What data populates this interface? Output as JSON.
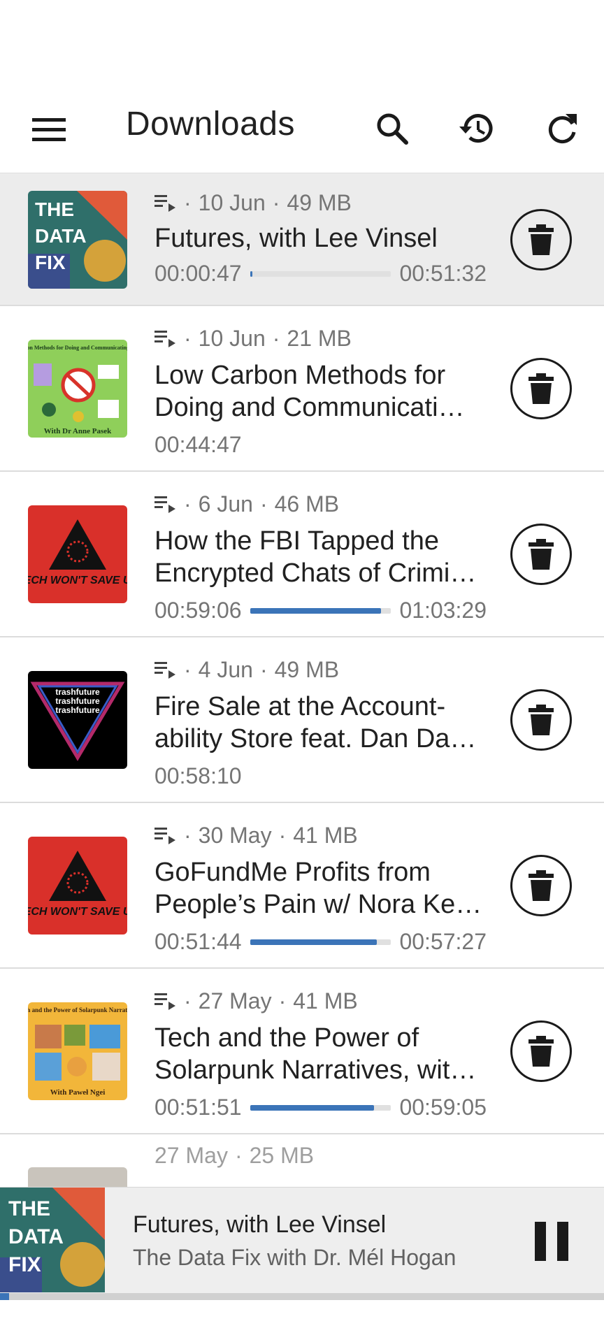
{
  "app": {
    "title": "Downloads",
    "accent_color": "#3b74b8"
  },
  "toolbar": {
    "menu_icon": "hamburger-icon",
    "search_icon": "search-icon",
    "history_icon": "history-icon",
    "refresh_icon": "refresh-icon"
  },
  "episodes": [
    {
      "date": "10 Jun",
      "size": "49 MB",
      "title": "Futures, with Lee Vinsel",
      "position": "00:00:47",
      "duration": "00:51:32",
      "progress": 0.015,
      "artwork": "The Data Fix",
      "artwork_lines": [
        "THE",
        "DATA",
        "FIX"
      ]
    },
    {
      "date": "10 Jun",
      "size": "21 MB",
      "title": "Low Carbon Methods for Doing and Communicati…",
      "duration": "00:44:47",
      "artwork": "Low Carbon Methods",
      "artwork_top": "Low Carbon Methods for Doing and Communicating Research",
      "artwork_bottom": "With Dr Anne Pasek"
    },
    {
      "date": "6 Jun",
      "size": "46 MB",
      "title": "How the FBI Tapped the Encrypted Chats of Crimi…",
      "position": "00:59:06",
      "duration": "01:03:29",
      "progress": 0.93,
      "artwork": "Tech Won't Save Us",
      "artwork_text": "TECH WON'T SAVE US"
    },
    {
      "date": "4 Jun",
      "size": "49 MB",
      "title": "Fire Sale at the Account-ability Store feat. Dan Da…",
      "duration": "00:58:10",
      "artwork": "Trashfuture",
      "artwork_text": "trashfuture"
    },
    {
      "date": "30 May",
      "size": "41 MB",
      "title": "GoFundMe Profits from People’s Pain w/ Nora Ke…",
      "position": "00:51:44",
      "duration": "00:57:27",
      "progress": 0.9,
      "artwork": "Tech Won't Save Us",
      "artwork_text": "TECH WON'T SAVE US"
    },
    {
      "date": "27 May",
      "size": "41 MB",
      "title": "Tech and the Power of Solarpunk Narratives, wit…",
      "position": "00:51:51",
      "duration": "00:59:05",
      "progress": 0.88,
      "artwork": "Solarpunk Narratives",
      "artwork_top": "Tech and the Power of Solarpunk Narratives",
      "artwork_bottom": "With Paweł Ngei"
    }
  ],
  "partial_episode": {
    "date": "27 May",
    "size": "25 MB"
  },
  "player": {
    "title": "Futures, with Lee Vinsel",
    "podcast": "The Data Fix with Dr. Mél Hogan",
    "progress": 0.015,
    "artwork_lines": [
      "THE",
      "DATA",
      "FIX"
    ]
  },
  "separator": "·"
}
